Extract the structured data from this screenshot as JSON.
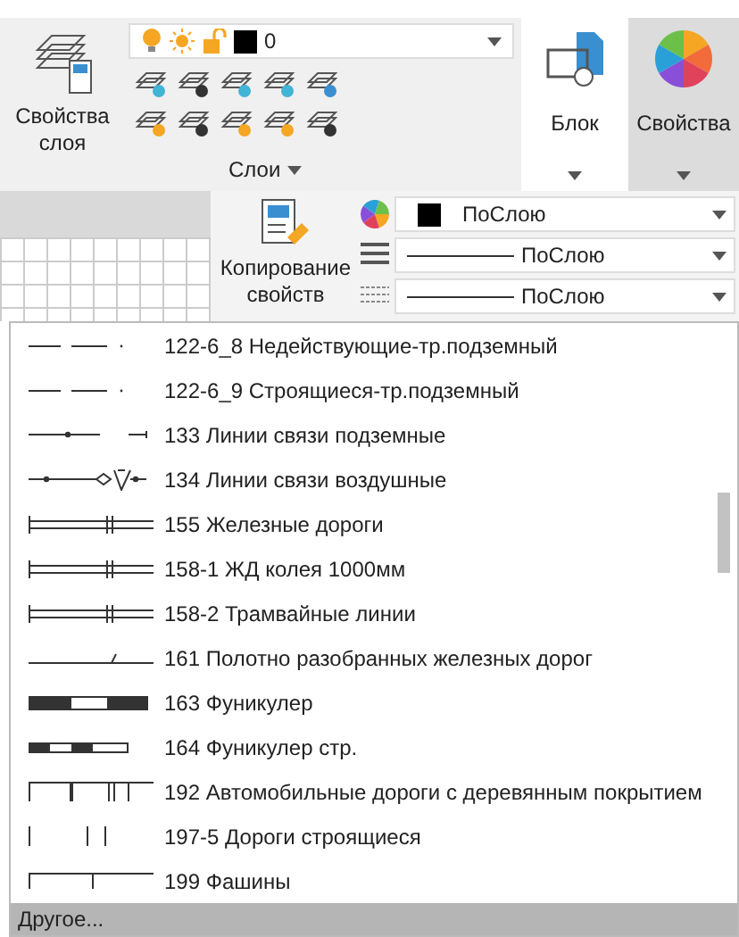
{
  "ribbon": {
    "layer_properties_button": {
      "label": "Свойства слоя"
    },
    "layer_dropdown": {
      "value": "0"
    },
    "layers_panel": {
      "label": "Слои"
    },
    "block_panel": {
      "label": "Блок"
    },
    "properties_panel": {
      "label": "Свойства"
    },
    "match_properties_button": {
      "label": "Копирование свойств"
    },
    "property_dropdowns": [
      {
        "kind": "color",
        "value": "ПоСлою"
      },
      {
        "kind": "lineweight",
        "value": "ПоСлою"
      },
      {
        "kind": "linetype",
        "value": "ПоСлою"
      }
    ]
  },
  "linetype_list": {
    "items": [
      {
        "label": "122-6_8 Недействующие-тр.подземный",
        "kind": "dash-dot"
      },
      {
        "label": "122-6_9 Строящиеся-тр.подземный",
        "kind": "dash-dot"
      },
      {
        "label": "133 Линии связи подземные",
        "kind": "cable-under"
      },
      {
        "label": "134 Линии связи воздушные",
        "kind": "cable-air"
      },
      {
        "label": "155 Железные дороги",
        "kind": "rail"
      },
      {
        "label": "158-1 ЖД колея 1000мм",
        "kind": "rail"
      },
      {
        "label": "158-2 Трамвайные линии",
        "kind": "rail"
      },
      {
        "label": "161 Полотно разобранных железных дорог",
        "kind": "slash"
      },
      {
        "label": "163 Фуникулер",
        "kind": "funicular"
      },
      {
        "label": "164 Фуникулер стр.",
        "kind": "funicular-small"
      },
      {
        "label": "192 Автомобильные дороги с деревянным покрытием",
        "kind": "road"
      },
      {
        "label": "197-5 Дороги строящиеся",
        "kind": "ticks"
      },
      {
        "label": "199 Фашины",
        "kind": "fascine"
      }
    ],
    "footer": "Другое..."
  }
}
